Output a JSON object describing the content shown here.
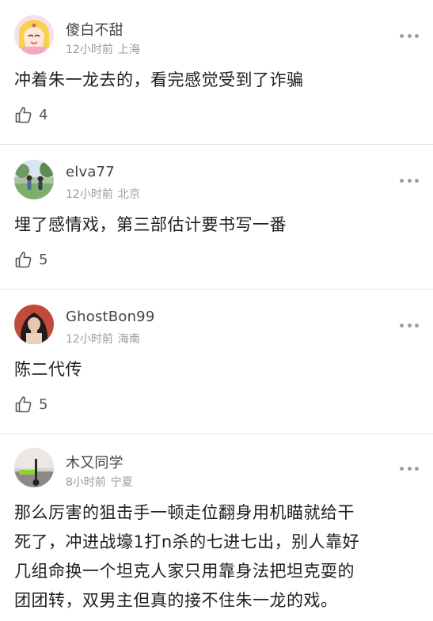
{
  "comments": [
    {
      "username": "傻白不甜",
      "time": "12小时前",
      "location": "上海",
      "text": "冲着朱一龙去的，看完感觉受到了诈骗",
      "likes": "4"
    },
    {
      "username": "elva77",
      "time": "12小时前",
      "location": "北京",
      "text": "埋了感情戏，第三部估计要书写一番",
      "likes": "5"
    },
    {
      "username": "GhostBon99",
      "time": "12小时前",
      "location": "海南",
      "text": "陈二代传",
      "likes": "5"
    },
    {
      "username": "木又同学",
      "time": "8小时前",
      "location": "宁夏",
      "text_lines": [
        "那么厉害的狙击手一顿走位翻身用机瞄就给干",
        "死了，冲进战壕1打n杀的七进七出，别人靠好",
        "几组命换一个坦克人家只用靠身法把坦克耍的",
        "团团转，双男主但真的接不住朱一龙的戏。"
      ]
    }
  ],
  "icons": {
    "like": "thumbs-up-icon",
    "more": "more-dots-icon"
  },
  "colors": {
    "divider": "#e4e4e4",
    "meta": "#9a9a9a",
    "text": "#1e1e1e"
  }
}
